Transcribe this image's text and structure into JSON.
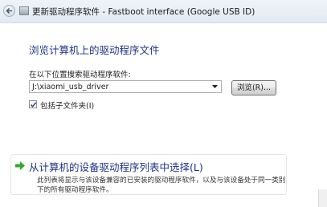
{
  "window": {
    "title": "更新驱动程序软件 - Fastboot interface (Google USB ID)"
  },
  "main": {
    "heading": "浏览计算机上的驱动程序文件",
    "path_label": "在以下位置搜索驱动程序软件:",
    "path_value": "J:\\xiaomi_usb_driver",
    "browse_label": "浏览(R)...",
    "include_subfolders_label": "包括子文件夹(I)",
    "include_subfolders_checked": true
  },
  "pick_option": {
    "title": "从计算机的设备驱动程序列表中选择(L)",
    "description": "此列表将显示与该设备兼容的已安装的驱动程序软件，以及与该设备处于同一类别下的所有驱动程序软件。",
    "arrow_color": "#2fa82f"
  },
  "icons": {
    "back": "back-arrow-icon",
    "window": "device-icon",
    "dropdown": "chevron-down-icon",
    "check": "checkmark-icon",
    "option": "green-arrow-icon"
  }
}
